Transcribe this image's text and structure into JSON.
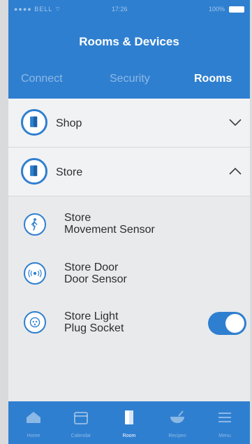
{
  "status_bar": {
    "carrier": "●●●● BELL ⌔",
    "time": "17:26",
    "battery": "100%"
  },
  "header": {
    "title": "Rooms & Devices"
  },
  "tabs": [
    {
      "label": "Connect",
      "active": false
    },
    {
      "label": "Security",
      "active": false
    },
    {
      "label": "Rooms",
      "active": true
    }
  ],
  "rooms": [
    {
      "name": "Shop",
      "icon": "door-icon",
      "expanded": false
    },
    {
      "name": "Store",
      "icon": "door-icon",
      "expanded": true
    }
  ],
  "devices": [
    {
      "name": "Store",
      "type": "Movement Sensor",
      "icon": "person-walking-icon"
    },
    {
      "name": "Store Door",
      "type": "Door Sensor",
      "icon": "door-sensor-icon"
    },
    {
      "name": "Store Light",
      "type": "Plug Socket",
      "icon": "plug-socket-icon",
      "toggle_on": true
    }
  ],
  "bottom_nav": [
    {
      "label": "Home",
      "icon": "home-icon",
      "active": false
    },
    {
      "label": "Calendar",
      "icon": "calendar-icon",
      "active": false
    },
    {
      "label": "Room",
      "icon": "door-icon",
      "active": true
    },
    {
      "label": "Recipes",
      "icon": "bowl-icon",
      "active": false
    },
    {
      "label": "Menu",
      "icon": "menu-icon",
      "active": false
    }
  ],
  "colors": {
    "accent": "#2f7fd0",
    "background": "#f1f2f4",
    "text": "#2b2e31"
  }
}
